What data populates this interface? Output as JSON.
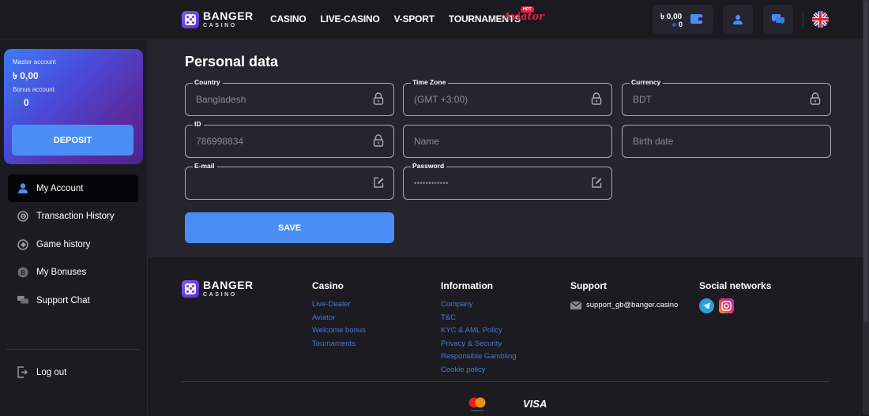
{
  "header": {
    "logo": {
      "brand": "BANGER",
      "sub": "CASINO"
    },
    "nav": [
      "CASINO",
      "LIVE-CASINO",
      "V-SPORT",
      "TOURNAMENTS"
    ],
    "aviator": {
      "label": "Aviator",
      "badge": "HOT"
    },
    "wallet": {
      "balance": "৳ 0,00",
      "bonus": "0",
      "icon": "wallet-icon"
    },
    "profile_icon": "user-icon",
    "chat_icon": "chat-icon",
    "language_icon": "uk-flag-icon"
  },
  "sidebar": {
    "card": {
      "master_label": "Master account",
      "master_value": "৳ 0,00",
      "bonus_label": "Bonus account",
      "bonus_value": "0",
      "deposit_label": "DEPOSIT"
    },
    "items": [
      {
        "label": "My Account",
        "icon": "user-icon",
        "active": true
      },
      {
        "label": "Transaction History",
        "icon": "coin-history-icon",
        "active": false
      },
      {
        "label": "Game history",
        "icon": "game-history-icon",
        "active": false
      },
      {
        "label": "My Bonuses",
        "icon": "bonus-b-icon",
        "active": false
      },
      {
        "label": "Support Chat",
        "icon": "chat-icon",
        "active": false
      }
    ],
    "logout_label": "Log out"
  },
  "main": {
    "title": "Personal data",
    "fields": {
      "country": {
        "label": "Country",
        "value": "Bangladesh",
        "icon": "lock-icon"
      },
      "timezone": {
        "label": "Time Zone",
        "value": "(GMT +3:00)",
        "icon": "lock-icon"
      },
      "currency": {
        "label": "Currency",
        "value": "BDT",
        "icon": "lock-icon"
      },
      "id": {
        "label": "ID",
        "value": "786998834",
        "icon": "lock-icon"
      },
      "name": {
        "placeholder": "Name"
      },
      "birth": {
        "placeholder": "Birth date"
      },
      "email": {
        "label": "E-mail",
        "value": "",
        "icon": "edit-icon"
      },
      "password": {
        "label": "Password",
        "value": "••••••••••••",
        "icon": "edit-icon"
      }
    },
    "save_label": "SAVE"
  },
  "footer": {
    "logo": {
      "brand": "BANGER",
      "sub": "CASINO"
    },
    "casino": {
      "title": "Casino",
      "links": [
        "Live-Dealer",
        "Aviator",
        "Welcome bonus",
        "Tournaments"
      ]
    },
    "information": {
      "title": "Information",
      "links": [
        "Company",
        "T&C",
        "KYC & AML Policy",
        "Privacy & Security",
        "Responsible Gambling",
        "Cookie policy"
      ]
    },
    "support": {
      "title": "Support",
      "email": "support_gb@banger.casino"
    },
    "social": {
      "title": "Social networks",
      "items": [
        "telegram-icon",
        "instagram-icon"
      ]
    },
    "payments": {
      "mastercard_caption": "mastercard",
      "visa": "VISA"
    }
  },
  "colors": {
    "accent": "#4a8ef5",
    "bg_main": "#26252f",
    "bg_dark": "#1c1b21",
    "aviator": "#e0243c",
    "link": "#4a78d4"
  }
}
